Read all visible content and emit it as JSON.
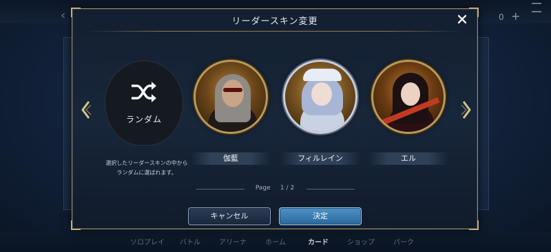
{
  "modal": {
    "title": "リーダースキン変更",
    "random_label": "ランダム",
    "random_description_line1": "選択したリーダースキンの中から",
    "random_description_line2": "ランダムに選ばれます。",
    "skins": [
      {
        "name": "伽藍"
      },
      {
        "name": "フィルレイン"
      },
      {
        "name": "エル"
      }
    ],
    "pager": {
      "label": "Page",
      "current": "1",
      "separator": "/",
      "total": "2"
    },
    "cancel_label": "キャンセル",
    "confirm_label": "決定"
  },
  "background_nav": {
    "items": [
      "ソロプレイ",
      "バトル",
      "アリーナ",
      "ホーム",
      "カード",
      "ショップ",
      "パーク"
    ],
    "active": "カード"
  },
  "background_top": {
    "counter": "0"
  },
  "colors": {
    "accent_gold": "#b79a5b",
    "confirm_blue": "#3a7cb2",
    "panel_bg": "#182638"
  }
}
